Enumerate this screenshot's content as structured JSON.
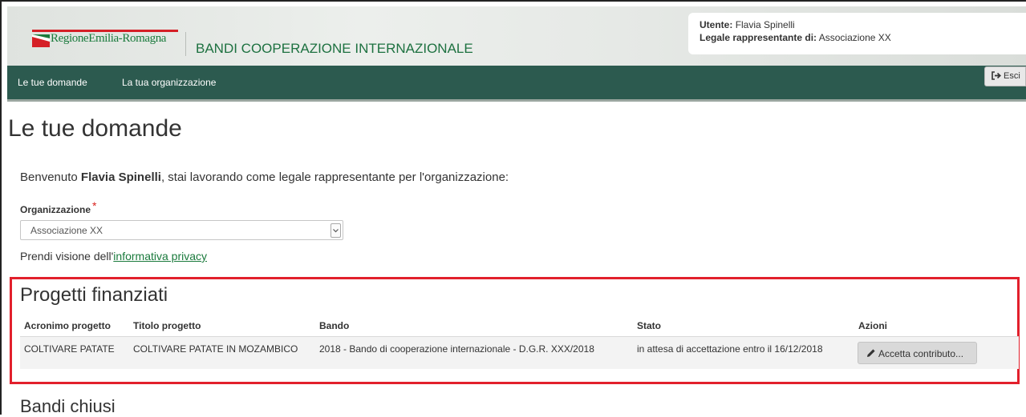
{
  "header": {
    "logo_text": "RegioneEmilia-Romagna",
    "app_title": "BANDI COOPERAZIONE INTERNAZIONALE",
    "user_label": "Utente:",
    "user_name": "Flavia Spinelli",
    "role_label": "Legale rappresentante di:",
    "role_org": "Associazione XX"
  },
  "nav": {
    "items": [
      {
        "label": "Le tue domande"
      },
      {
        "label": "La tua organizzazione"
      }
    ],
    "logout_label": "Esci"
  },
  "main": {
    "page_title": "Le tue domande",
    "welcome_prefix": "Benvenuto",
    "welcome_name": "Flavia Spinelli",
    "welcome_suffix": ", stai lavorando come legale rappresentante per l'organizzazione:",
    "org_label": "Organizzazione",
    "required_mark": "*",
    "org_selected": "Associazione XX",
    "privacy_prefix": "Prendi visione dell'",
    "privacy_link": "informativa privacy"
  },
  "funded_projects": {
    "title": "Progetti finanziati",
    "columns": [
      "Acronimo progetto",
      "Titolo progetto",
      "Bando",
      "Stato",
      "Azioni"
    ],
    "rows": [
      {
        "acronimo": "COLTIVARE PATATE",
        "titolo": "COLTIVARE PATATE IN MOZAMBICO",
        "bando": "2018 - Bando di cooperazione internazionale - D.G.R. XXX/2018",
        "stato": "in attesa di accettazione entro il 16/12/2018",
        "azione": "Accetta contributo..."
      }
    ]
  },
  "closed_calls": {
    "title": "Bandi chiusi"
  },
  "colors": {
    "nav_bg": "#2c5a4f",
    "brand_green": "#1a7a3c",
    "highlight_red": "#e2202c"
  },
  "icons": {
    "logout": "sign-out-icon",
    "action": "pencil-icon",
    "select": "chevron-down-icon"
  }
}
